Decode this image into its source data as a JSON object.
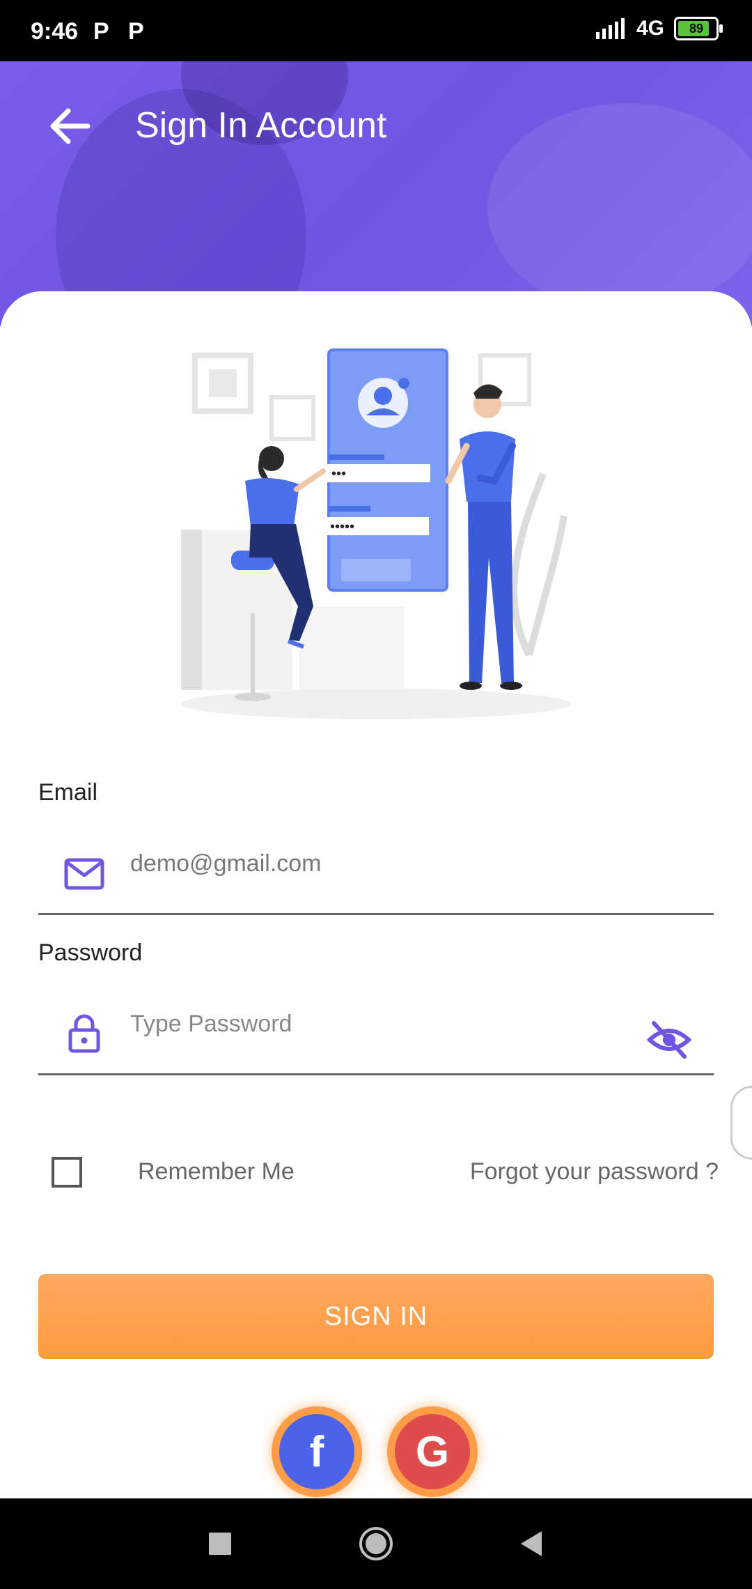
{
  "status_bar": {
    "time": "9:46",
    "notification_icons": [
      "P",
      "P"
    ],
    "network": "4G",
    "battery": "89"
  },
  "header": {
    "title": "Sign In Account",
    "back_icon": "arrow-left-icon"
  },
  "form": {
    "email_label": "Email",
    "email_value": "demo@gmail.com",
    "password_label": "Password",
    "password_placeholder": "Type Password",
    "remember_label": "Remember Me",
    "forgot_label": "Forgot your password ?",
    "signin_label": "SIGN IN"
  },
  "social": {
    "facebook_glyph": "f",
    "google_glyph": "G"
  },
  "colors": {
    "accent_purple": "#6f55e2",
    "button_orange": "#ff9a3e",
    "facebook_blue": "#4a63e8",
    "google_red": "#e04b4b"
  },
  "icons": [
    "mail-icon",
    "lock-icon",
    "eye-off-icon",
    "facebook-icon",
    "google-icon",
    "nav-recents-icon",
    "nav-home-icon",
    "nav-back-icon"
  ]
}
